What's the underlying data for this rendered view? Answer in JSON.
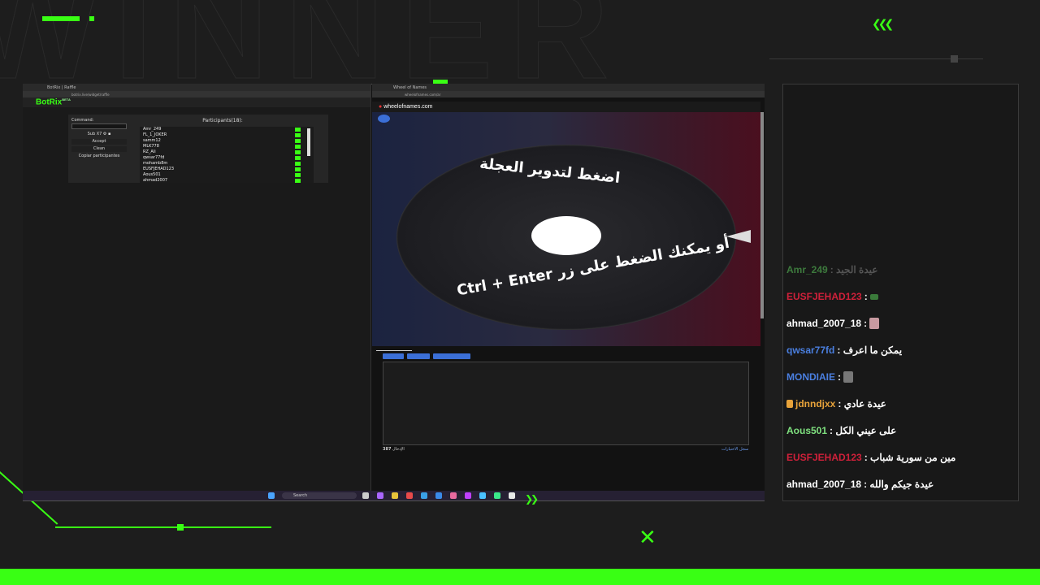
{
  "overlay": {
    "chevrons_top": "❮❮❮",
    "chevrons_bottom": "❯❯",
    "x_mark": "✕",
    "colors": {
      "accent": "#39ff14",
      "background": "#1d1d1d"
    }
  },
  "left_window": {
    "tab_title": "BotRix | Raffle",
    "url": "botrix.live/widget/raffle",
    "logo": "BotRix",
    "logo_beta": "BETA",
    "command_label": "Command:",
    "sub_label": "Sub X7",
    "accept_button": "Accept",
    "clean_button": "Clean",
    "copy_button": "Copiar participantes",
    "participants_title": "Participants(18):",
    "participants": [
      "Amr_249",
      "FL_1_JOKER",
      "samm12",
      "MLK778",
      "RZ_Ali",
      "qwsar77fd",
      "mohamb8m",
      "EUSFJEHAD123",
      "Aous501",
      "ahmad2007"
    ]
  },
  "right_window": {
    "tab_title": "Wheel of Names",
    "url": "wheelofnames.com/ar",
    "brand": "wheelofnames.com",
    "wheel_text_top": "اضغط لتدوير العجلة",
    "wheel_text_bottom": "أو يمكنك الضغط على زر Ctrl + Enter",
    "entries_count": "387",
    "entries_count_label": "الإدخال",
    "entries_link": "سجل الاختيارات"
  },
  "taskbar": {
    "search_placeholder": "Search"
  },
  "chat": {
    "messages": [
      {
        "user": "Amr_249",
        "text": ": عيدة الجيد",
        "color": "#3d7a3d"
      },
      {
        "user": "EUSFJEHAD123",
        "text": ":",
        "color": "#d0203a"
      },
      {
        "user": "ahmad_2007_18",
        "text": ":",
        "color": "#ffffff"
      },
      {
        "user": "qwsar77fd",
        "text": ": يمكن ما اعرف",
        "color": "#4a7fe0"
      },
      {
        "user": "MONDIAIE",
        "text": ":",
        "color": "#4a7fe0"
      },
      {
        "user": "jdnndjxx",
        "text": ": عيدة عادي",
        "color": "#e8a33a"
      },
      {
        "user": "Aous501",
        "text": ": على عيني الكل",
        "color": "#7fe07f"
      },
      {
        "user": "EUSFJEHAD123",
        "text": ": مين من سورية شباب",
        "color": "#d0203a"
      },
      {
        "user": "ahmad_2007_18",
        "text": ": عيدة جيكم والله",
        "color": "#ffffff"
      }
    ]
  }
}
